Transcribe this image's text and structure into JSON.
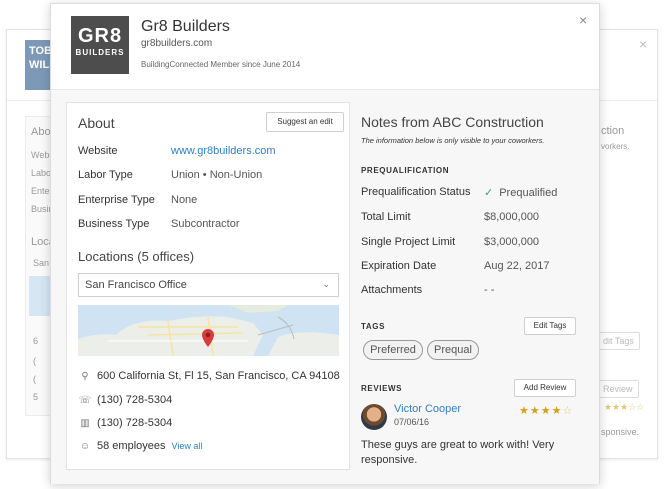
{
  "background_card": {
    "logo_text": "TOB WILS",
    "about": "Abo",
    "rows": [
      "Webs",
      "Labo",
      "Enter",
      "Busin"
    ],
    "locations": "Loca",
    "location_input": "San",
    "icon_texts": [
      "6",
      "(",
      "(",
      "5"
    ],
    "right_heading": "ction",
    "right_sub": "vorkers.",
    "edit_tags": "dit Tags",
    "review": "Review",
    "sponsive": "sponsive."
  },
  "header": {
    "logo_big": "GR8",
    "logo_small": "BUILDERS",
    "company_name": "Gr8 Builders",
    "company_url": "gr8builders.com",
    "member_since": "BuildingConnected Member since June 2014",
    "close": "×"
  },
  "about": {
    "title": "About",
    "suggest_edit": "Suggest an edit",
    "fields": [
      {
        "label": "Website",
        "value": "www.gr8builders.com"
      },
      {
        "label": "Labor Type",
        "value": "Union • Non-Union"
      },
      {
        "label": "Enterprise Type",
        "value": "None"
      },
      {
        "label": "Business Type",
        "value": "Subcontractor"
      }
    ]
  },
  "locations": {
    "title": "Locations (5 offices)",
    "selected_office": "San Francisco Office",
    "address": "600 California St, Fl 15, San Francisco, CA 94108",
    "phone": "(130) 728-5304",
    "fax": "(130) 728-5304",
    "employees": "58 employees",
    "view_all": "View all"
  },
  "notes": {
    "title": "Notes from ABC Construction",
    "subtitle": "The information below is only visible to your coworkers."
  },
  "prequalification": {
    "heading": "PREQUALIFICATION",
    "rows": [
      {
        "label": "Prequalification Status",
        "value": "Prequalified"
      },
      {
        "label": "Total Limit",
        "value": "$8,000,000"
      },
      {
        "label": "Single Project Limit",
        "value": "$3,000,000"
      },
      {
        "label": "Expiration Date",
        "value": "Aug 22, 2017"
      },
      {
        "label": "Attachments",
        "value": "- -"
      }
    ]
  },
  "tags": {
    "heading": "TAGS",
    "edit_label": "Edit Tags",
    "items": [
      "Preferred",
      "Prequal"
    ]
  },
  "reviews": {
    "heading": "REVIEWS",
    "add_label": "Add Review",
    "reviewer": "Victor Cooper",
    "date": "07/06/16",
    "rating": 4,
    "max_rating": 5,
    "text": "These guys are great to work with! Very responsive."
  },
  "colors": {
    "link": "#2f80c5",
    "check": "#3aa35a",
    "star": "#d4a017",
    "logo_bg": "#4d4d4d"
  }
}
